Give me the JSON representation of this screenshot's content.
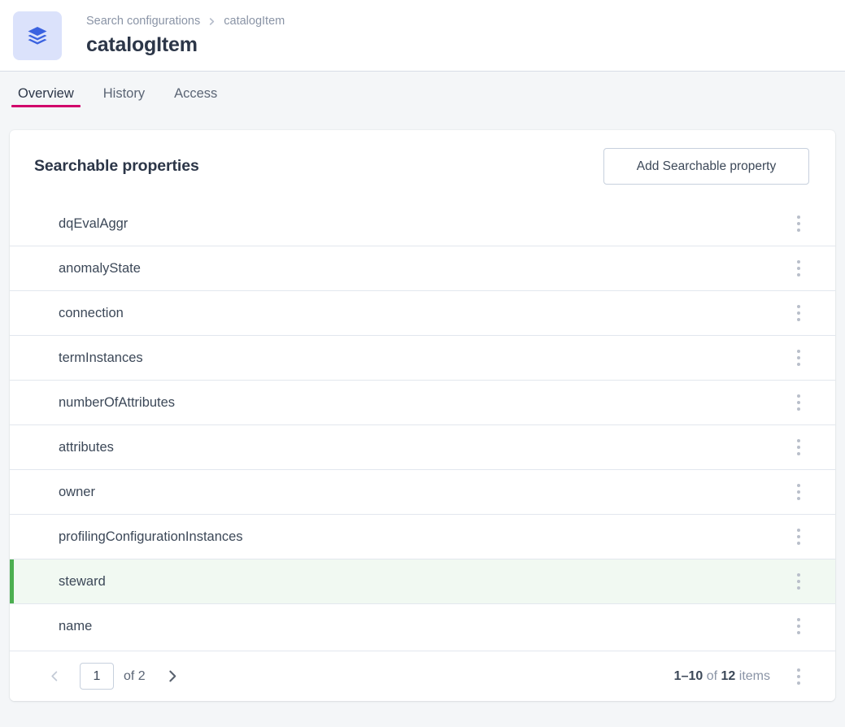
{
  "header": {
    "app_icon": "layers-icon",
    "breadcrumb": {
      "parent": "Search configurations",
      "separator": "chevron-right-icon",
      "current": "catalogItem"
    },
    "title": "catalogItem"
  },
  "tabs": [
    {
      "label": "Overview",
      "active": true
    },
    {
      "label": "History",
      "active": false
    },
    {
      "label": "Access",
      "active": false
    }
  ],
  "card": {
    "title": "Searchable properties",
    "add_button_label": "Add Searchable property",
    "row_menu_icon": "kebab-menu-icon",
    "rows": [
      {
        "label": "dqEvalAggr",
        "selected": false
      },
      {
        "label": "anomalyState",
        "selected": false
      },
      {
        "label": "connection",
        "selected": false
      },
      {
        "label": "termInstances",
        "selected": false
      },
      {
        "label": "numberOfAttributes",
        "selected": false
      },
      {
        "label": "attributes",
        "selected": false
      },
      {
        "label": "owner",
        "selected": false
      },
      {
        "label": "profilingConfigurationInstances",
        "selected": false
      },
      {
        "label": "steward",
        "selected": true
      },
      {
        "label": "name",
        "selected": false
      }
    ]
  },
  "pagination": {
    "prev_icon": "chevron-left-icon",
    "next_icon": "chevron-right-icon",
    "page_value": "1",
    "of_label": "of 2",
    "range": "1–10",
    "of_word": "of",
    "total": "12",
    "items_word": "items",
    "footer_menu_icon": "kebab-menu-icon"
  },
  "colors": {
    "accent_tab_underline": "#d1006b",
    "selected_row_border": "#4caf50",
    "selected_row_bg": "#f1f9f2",
    "app_icon_tile_bg": "#dbe2fb",
    "app_icon_fg": "#3a62e0",
    "page_bg": "#f4f6f8"
  }
}
